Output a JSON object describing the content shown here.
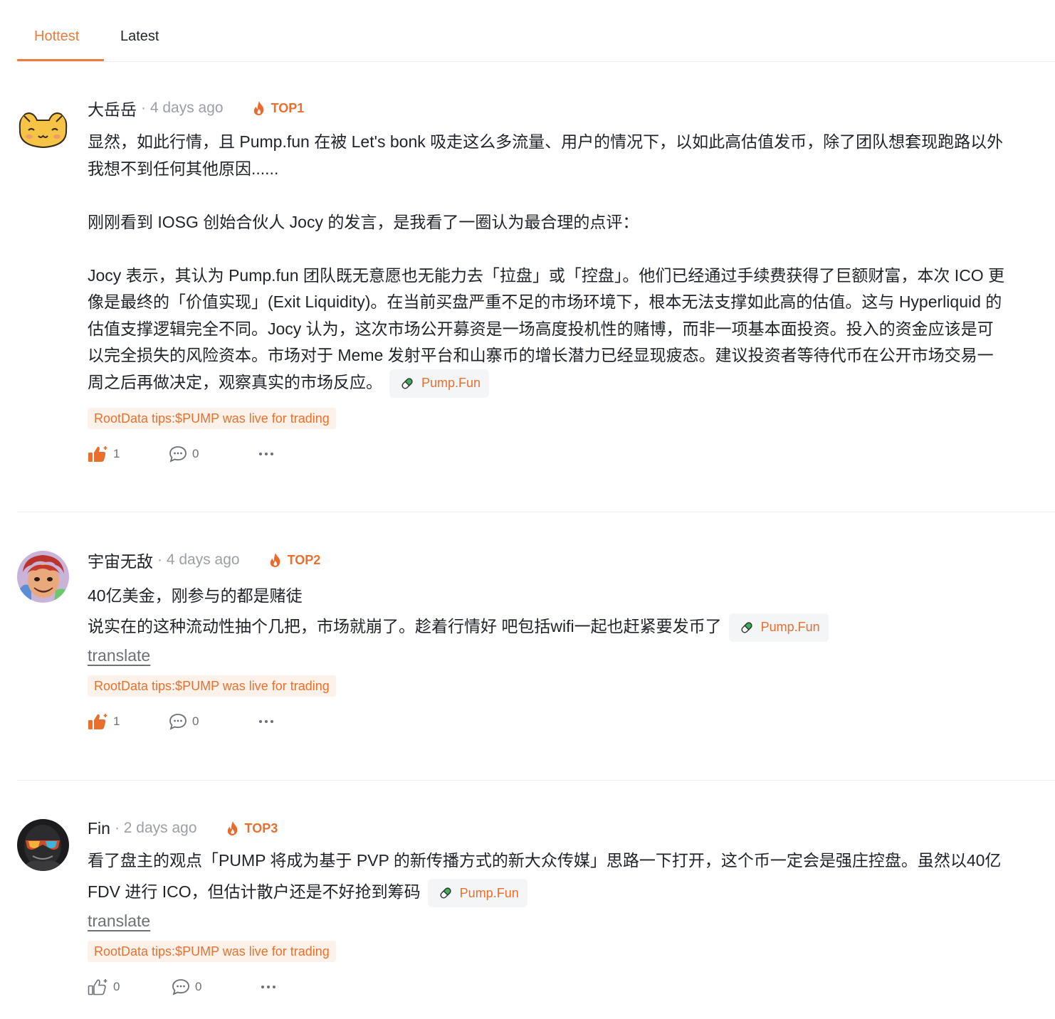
{
  "tabs": {
    "hottest": "Hottest",
    "latest": "Latest"
  },
  "accent_color": "#ea7b3c",
  "comments": [
    {
      "author": "大岳岳",
      "time": "· 4 days ago",
      "rank": "TOP1",
      "paragraphs": [
        "显然，如此行情，且 Pump.fun 在被 Let's bonk 吸走这么多流量、用户的情况下，以如此高估值发币，除了团队想套现跑路以外我想不到任何其他原因......",
        "刚刚看到 IOSG 创始合伙人 Jocy 的发言，是我看了一圈认为最合理的点评：",
        "Jocy 表示，其认为 Pump.fun 团队既无意愿也无能力去「拉盘」或「控盘」。他们已经通过手续费获得了巨额财富，本次 ICO 更像是最终的「价值实现」(Exit Liquidity)。在当前买盘严重不足的市场环境下，根本无法支撑如此高的估值。这与 Hyperliquid 的估值支撑逻辑完全不同。Jocy 认为，这次市场公开募资是一场高度投机性的赌博，而非一项基本面投资。投入的资金应该是可以完全损失的风险资本。市场对于 Meme 发射平台和山寨币的增长潜力已经显现疲态。建议投资者等待代币在公开市场交易一周之后再做决定，观察真实的市场反应。"
      ],
      "project": "Pump.Fun",
      "tip": "RootData tips:$PUMP was live for trading",
      "likes": "1",
      "replies": "0",
      "liked": true,
      "avatar_icon": "cartoon-cat-avatar"
    },
    {
      "author": "宇宙无敌",
      "time": "· 4 days ago",
      "rank": "TOP2",
      "lines": [
        "40亿美金，刚参与的都是赌徒",
        "说实在的这种流动性抽个几把，市场就崩了。趁着行情好 吧包括wifi一起也赶紧要发币了"
      ],
      "project": "Pump.Fun",
      "translate": "translate",
      "tip": "RootData tips:$PUMP was live for trading",
      "likes": "1",
      "replies": "0",
      "liked": true,
      "avatar_icon": "anime-character-avatar"
    },
    {
      "author": "Fin",
      "time": "· 2 days ago",
      "rank": "TOP3",
      "text": "看了盘主的观点「PUMP 将成为基于 PVP 的新传播方式的新大众传媒」思路一下打开，这个币一定会是强庄控盘。虽然以40亿 FDV 进行 ICO，但估计散户还是不好抢到筹码",
      "project": "Pump.Fun",
      "translate": "translate",
      "tip": "RootData tips:$PUMP was live for trading",
      "likes": "0",
      "replies": "0",
      "liked": false,
      "avatar_icon": "dark-sunglasses-avatar"
    }
  ]
}
